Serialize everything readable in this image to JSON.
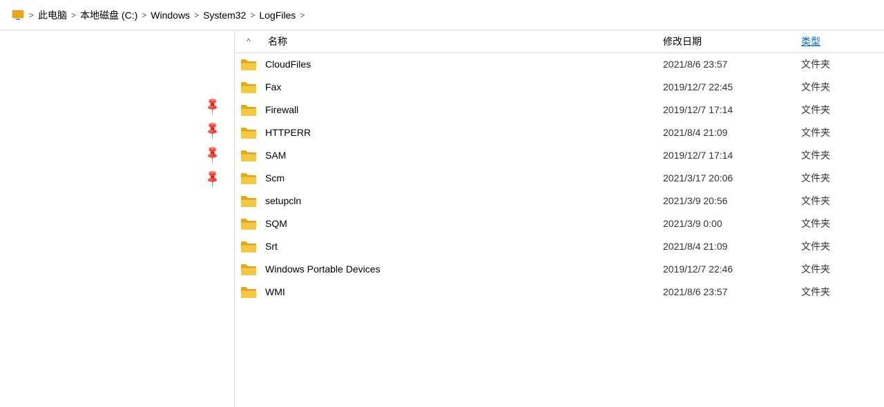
{
  "breadcrumb": {
    "items": [
      {
        "label": "此电脑",
        "icon": "computer-icon"
      },
      {
        "label": "本地磁盘 (C:)",
        "icon": "disk-icon"
      },
      {
        "label": "Windows",
        "icon": "folder-icon"
      },
      {
        "label": "System32",
        "icon": "folder-icon"
      },
      {
        "label": "LogFiles",
        "icon": "folder-icon"
      }
    ],
    "separator": ">"
  },
  "columns": {
    "sort_arrow": "^",
    "name": "名称",
    "date": "修改日期",
    "type": "类型"
  },
  "files": [
    {
      "name": "CloudFiles",
      "date": "2021/8/6 23:57",
      "type": "文件夹"
    },
    {
      "name": "Fax",
      "date": "2019/12/7 22:45",
      "type": "文件夹"
    },
    {
      "name": "Firewall",
      "date": "2019/12/7 17:14",
      "type": "文件夹"
    },
    {
      "name": "HTTPERR",
      "date": "2021/8/4 21:09",
      "type": "文件夹"
    },
    {
      "name": "SAM",
      "date": "2019/12/7 17:14",
      "type": "文件夹"
    },
    {
      "name": "Scm",
      "date": "2021/3/17 20:06",
      "type": "文件夹"
    },
    {
      "name": "setupcln",
      "date": "2021/3/9 20:56",
      "type": "文件夹"
    },
    {
      "name": "SQM",
      "date": "2021/3/9 0:00",
      "type": "文件夹"
    },
    {
      "name": "Srt",
      "date": "2021/8/4 21:09",
      "type": "文件夹"
    },
    {
      "name": "Windows Portable Devices",
      "date": "2019/12/7 22:46",
      "type": "文件夹"
    },
    {
      "name": "WMI",
      "date": "2021/8/6 23:57",
      "type": "文件夹"
    }
  ],
  "pins": [
    "pin1",
    "pin2",
    "pin3",
    "pin4"
  ],
  "icons": {
    "computer": "💻",
    "folder_color": "#E6A817",
    "folder_dark": "#C8860A"
  }
}
